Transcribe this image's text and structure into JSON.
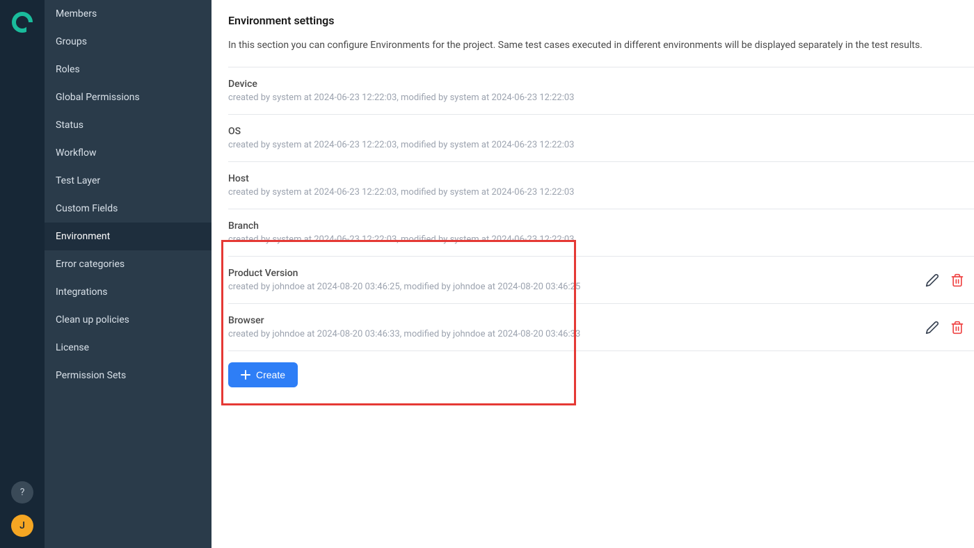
{
  "rail": {
    "avatar_initial": "J",
    "help_label": "?"
  },
  "sidebar": {
    "items": [
      {
        "label": "Members",
        "active": false
      },
      {
        "label": "Groups",
        "active": false
      },
      {
        "label": "Roles",
        "active": false
      },
      {
        "label": "Global Permissions",
        "active": false
      },
      {
        "label": "Status",
        "active": false
      },
      {
        "label": "Workflow",
        "active": false
      },
      {
        "label": "Test Layer",
        "active": false
      },
      {
        "label": "Custom Fields",
        "active": false
      },
      {
        "label": "Environment",
        "active": true
      },
      {
        "label": "Error categories",
        "active": false
      },
      {
        "label": "Integrations",
        "active": false
      },
      {
        "label": "Clean up policies",
        "active": false
      },
      {
        "label": "License",
        "active": false
      },
      {
        "label": "Permission Sets",
        "active": false
      }
    ]
  },
  "main": {
    "title": "Environment settings",
    "description": "In this section you can configure Environments for the project. Same test cases executed in different environments will be displayed separately in the test results.",
    "create_label": "Create",
    "environments": [
      {
        "name": "Device",
        "meta": "created by system at 2024-06-23 12:22:03, modified by system at 2024-06-23 12:22:03",
        "show_actions": false
      },
      {
        "name": "OS",
        "meta": "created by system at 2024-06-23 12:22:03, modified by system at 2024-06-23 12:22:03",
        "show_actions": false
      },
      {
        "name": "Host",
        "meta": "created by system at 2024-06-23 12:22:03, modified by system at 2024-06-23 12:22:03",
        "show_actions": false
      },
      {
        "name": "Branch",
        "meta": "created by system at 2024-06-23 12:22:03, modified by system at 2024-06-23 12:22:03",
        "show_actions": false
      },
      {
        "name": "Product Version",
        "meta": "created by johndoe at 2024-08-20 03:46:25, modified by johndoe at 2024-08-20 03:46:25",
        "show_actions": true
      },
      {
        "name": "Browser",
        "meta": "created by johndoe at 2024-08-20 03:46:33, modified by johndoe at 2024-08-20 03:46:33",
        "show_actions": true
      }
    ]
  }
}
